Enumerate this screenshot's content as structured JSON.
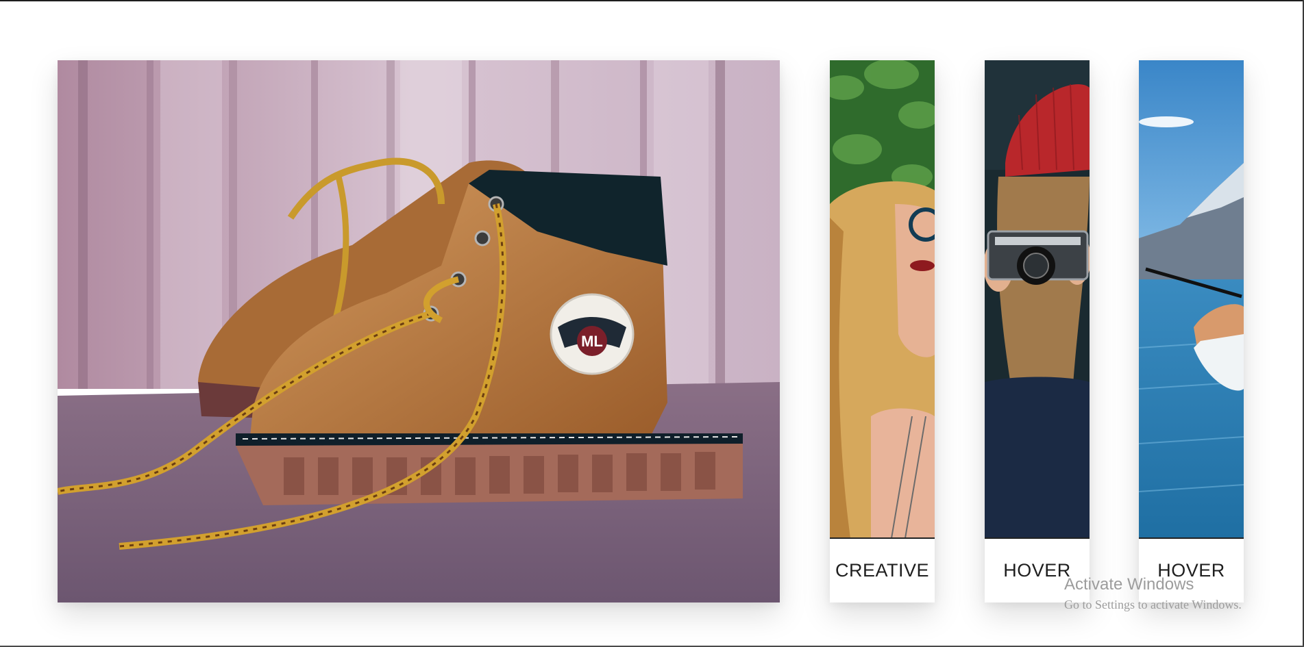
{
  "gallery": {
    "featured": {
      "image_alt": "Brown lace-up toddler boots on wooden backdrop",
      "badge_text": "ML"
    },
    "cards": [
      {
        "label": "CREATIVE",
        "image_alt": "Woman with long blonde hair and glasses"
      },
      {
        "label": "HOVER",
        "image_alt": "Person in red beanie holding a camera"
      },
      {
        "label": "HOVER",
        "image_alt": "Kayaker on a blue mountain lake"
      }
    ]
  },
  "watermark": {
    "title": "Activate Windows",
    "subtitle": "Go to Settings to activate Windows."
  },
  "colors": {
    "label_text": "#1f1f1f",
    "watermark_text": "#9c9c9c",
    "boot_leather": "#b5753b",
    "lake_blue": "#3a8bc0"
  }
}
